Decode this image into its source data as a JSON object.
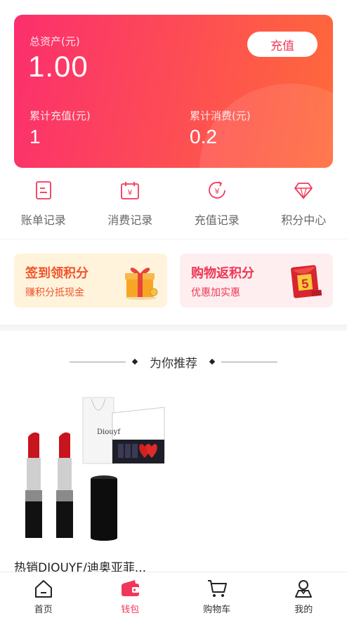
{
  "wallet": {
    "total_label": "总资产(元)",
    "total_value": "1.00",
    "recharge_button": "充值",
    "recharged_label": "累计充值(元)",
    "recharged_value": "1",
    "consumed_label": "累计消费(元)",
    "consumed_value": "0.2"
  },
  "quick_links": [
    {
      "label": "账单记录",
      "icon": "bill-icon"
    },
    {
      "label": "消费记录",
      "icon": "calendar-yen-icon"
    },
    {
      "label": "充值记录",
      "icon": "recharge-yen-icon"
    },
    {
      "label": "积分中心",
      "icon": "diamond-icon"
    }
  ],
  "promos": {
    "sign": {
      "title": "签到领积分",
      "subtitle": "赚积分抵现金",
      "icon": "gift-box-icon"
    },
    "shop": {
      "title": "购物返积分",
      "subtitle": "优惠加实惠",
      "icon": "red-envelope-icon",
      "badge": "5"
    }
  },
  "recommend": {
    "title": "为你推荐",
    "products": [
      {
        "name": "热销DIOUYF/迪奥亚菲...",
        "brand_text": "Diouyf"
      }
    ]
  },
  "tabbar": [
    {
      "label": "首页",
      "icon": "home-icon",
      "active": false
    },
    {
      "label": "钱包",
      "icon": "wallet-icon",
      "active": true
    },
    {
      "label": "购物车",
      "icon": "cart-icon",
      "active": false
    },
    {
      "label": "我的",
      "icon": "user-icon",
      "active": false
    }
  ],
  "colors": {
    "accent": "#f0375a",
    "gradient_start": "#fb2f6d",
    "gradient_end": "#ff6a39",
    "sign_bg": "#fff3dc",
    "shop_bg": "#ffeef0"
  }
}
